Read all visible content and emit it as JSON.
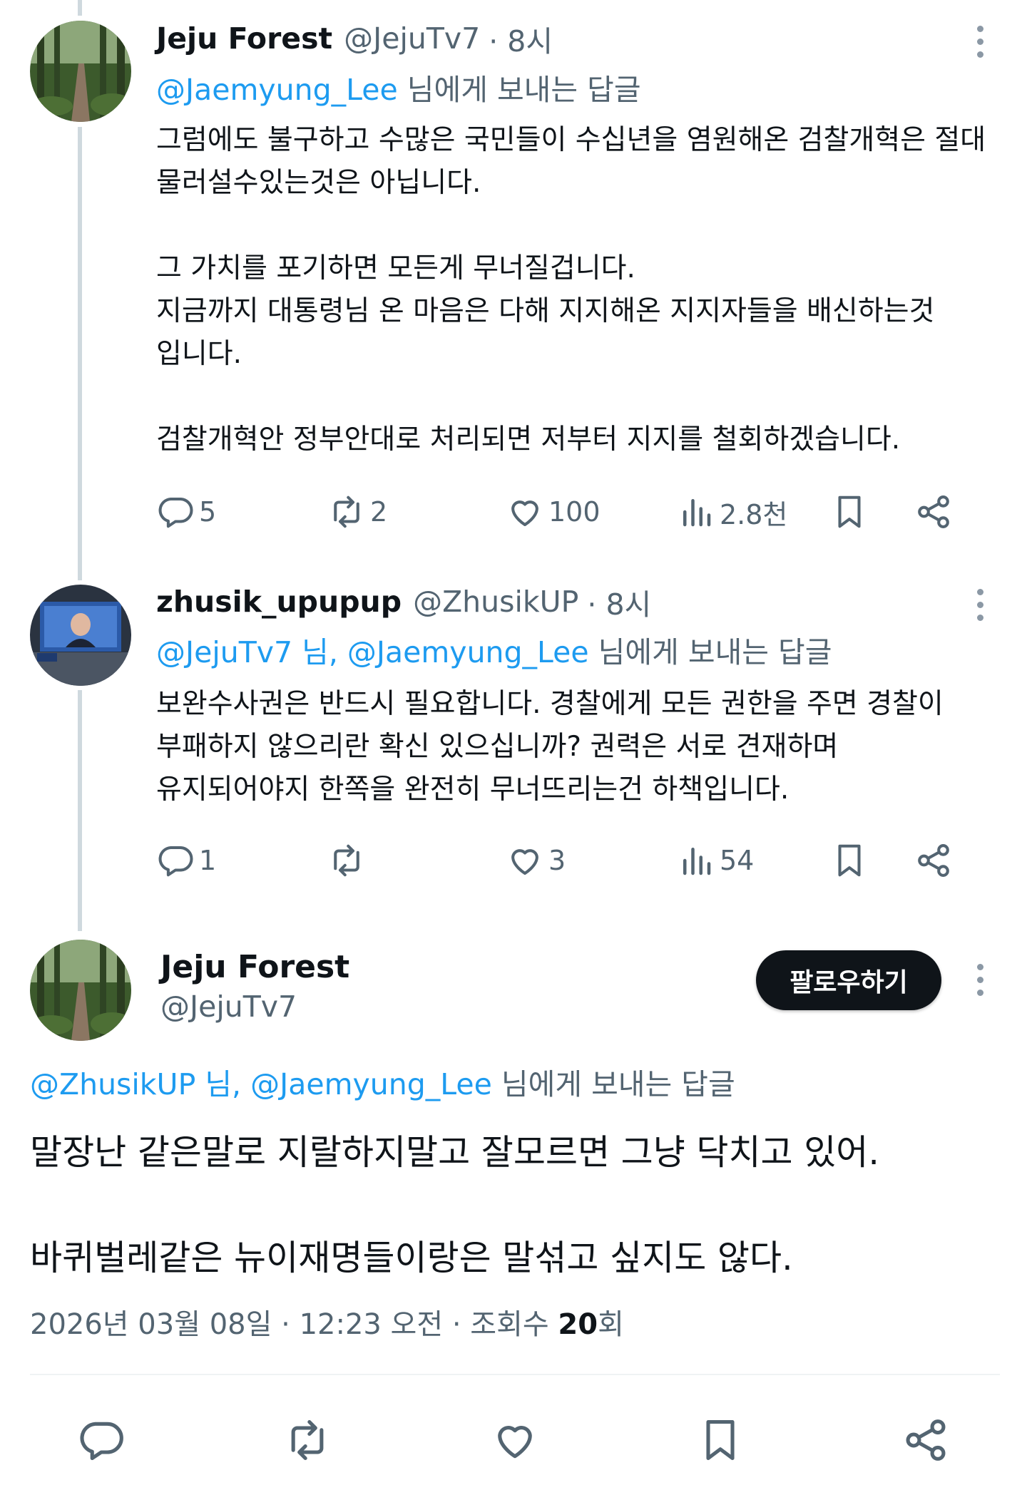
{
  "tweets": [
    {
      "name": "Jeju Forest",
      "handle": "@JejuTv7",
      "time": "· 8시",
      "reply_to": {
        "mention1": "@Jaemyung_Lee",
        "suffix": " 님에게 보내는 답글"
      },
      "body": "그럼에도 불구하고 수많은 국민들이 수십년을 염원해온 검찰개혁은 절대\n물러설수있는것은 아닙니다.\n\n그 가치를 포기하면 모든게 무너질겁니다.\n지금까지 대통령님 온 마음은 다해 지지해온 지지자들을 배신하는것\n입니다.\n\n검찰개혁안 정부안대로 처리되면 저부터 지지를 철회하겠습니다.",
      "stats": {
        "replies": "5",
        "reposts": "2",
        "likes": "100",
        "views": "2.8천"
      }
    },
    {
      "name": "zhusik_upupup",
      "handle": "@ZhusikUP",
      "time": "· 8시",
      "reply_to": {
        "mention1": "@JejuTv7",
        "sep": " 님, ",
        "mention2": "@Jaemyung_Lee",
        "suffix": " 님에게 보내는 답글"
      },
      "body": "보완수사권은 반드시 필요합니다. 경찰에게 모든 권한을 주면 경찰이\n부패하지 않으리란 확신 있으십니까? 권력은 서로 견재하며\n유지되어야지 한쪽을 완전히 무너뜨리는건 하책입니다.",
      "stats": {
        "replies": "1",
        "reposts": "",
        "likes": "3",
        "views": "54"
      }
    }
  ],
  "main": {
    "name": "Jeju Forest",
    "handle": "@JejuTv7",
    "follow_label": "팔로우하기",
    "reply_to": {
      "mention1": "@ZhusikUP",
      "sep": " 님, ",
      "mention2": "@Jaemyung_Lee",
      "suffix": " 님에게 보내는 답글"
    },
    "body": "말장난 같은말로 지랄하지말고 잘모르면 그냥 닥치고 있어.\n\n바퀴벌레같은 뉴이재명들이랑은 말섞고 싶지도 않다.",
    "meta_prefix": "2026년 03월 08일 · 12:23 오전 · 조회수 ",
    "meta_views": "20",
    "meta_suffix": "회"
  },
  "icons": {
    "reply": "speech-bubble-icon",
    "repost": "repost-arrows-icon",
    "like": "heart-icon",
    "views": "bar-chart-icon",
    "bookmark": "bookmark-icon",
    "share": "share-nodes-icon",
    "more": "vertical-ellipsis-icon"
  },
  "colors": {
    "link": "#1d9bf0",
    "secondary_text": "#536471",
    "primary_text": "#0f1419",
    "thread_line": "#cfd9de",
    "follow_button": "#0f1419"
  }
}
